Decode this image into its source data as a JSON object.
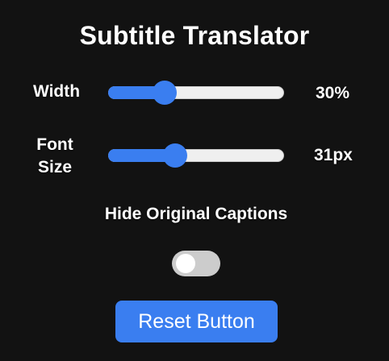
{
  "title": "Subtitle Translator",
  "colors": {
    "background": "#121212",
    "accent": "#3a7ef0",
    "track": "#efefef",
    "toggle_off": "#cccccc",
    "text": "#ffffff"
  },
  "width_control": {
    "label": "Width",
    "value_text": "30%",
    "slider_fraction": 0.32
  },
  "font_size_control": {
    "label": "Font Size",
    "value_text": "31px",
    "slider_fraction": 0.38
  },
  "hide_captions": {
    "label": "Hide Original Captions",
    "enabled": false
  },
  "reset_button": {
    "label": "Reset Button"
  }
}
